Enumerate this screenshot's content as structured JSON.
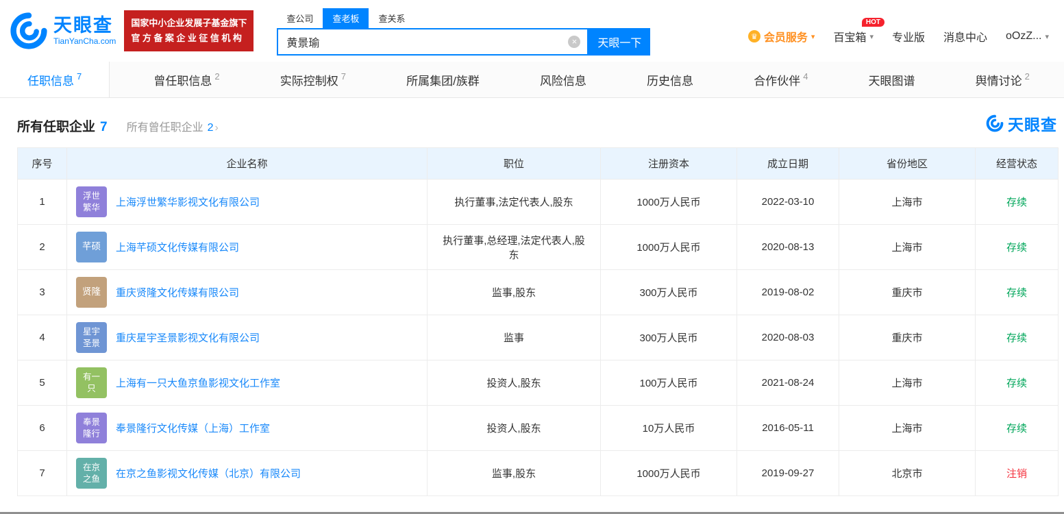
{
  "header": {
    "logo": {
      "brand": "天眼查",
      "domain": "TianYanCha.com"
    },
    "badge_line1": "国家中小企业发展子基金旗下",
    "badge_line2": "官方备案企业征信机构",
    "search": {
      "tabs": [
        {
          "name": "search-company",
          "label": "查公司",
          "active": false
        },
        {
          "name": "search-boss",
          "label": "查老板",
          "active": true
        },
        {
          "name": "search-relation",
          "label": "查关系",
          "active": false
        }
      ],
      "value": "黄景瑜",
      "button": "天眼一下"
    },
    "nav": [
      {
        "name": "vip-services",
        "label": "会员服务",
        "icon": "crown-icon",
        "accent": true,
        "caret": true
      },
      {
        "name": "toolbox",
        "label": "百宝箱",
        "badge": "HOT",
        "caret": true
      },
      {
        "name": "pro-version",
        "label": "专业版"
      },
      {
        "name": "message-center",
        "label": "消息中心"
      },
      {
        "name": "user-menu",
        "label": "oOzZ...",
        "caret": true
      }
    ]
  },
  "tabs": [
    {
      "name": "employment-info",
      "label": "任职信息",
      "count": "7",
      "active": true
    },
    {
      "name": "past-employment-info",
      "label": "曾任职信息",
      "count": "2",
      "active": false
    },
    {
      "name": "actual-control",
      "label": "实际控制权",
      "count": "7",
      "active": false
    },
    {
      "name": "group-cluster",
      "label": "所属集团/族群",
      "count": "",
      "active": false
    },
    {
      "name": "risk-info",
      "label": "风险信息",
      "count": "",
      "active": false
    },
    {
      "name": "history-info",
      "label": "历史信息",
      "count": "",
      "active": false
    },
    {
      "name": "partners",
      "label": "合作伙伴",
      "count": "4",
      "active": false
    },
    {
      "name": "tianyan-graph",
      "label": "天眼图谱",
      "count": "",
      "active": false
    },
    {
      "name": "public-opinion",
      "label": "舆情讨论",
      "count": "2",
      "active": false
    }
  ],
  "section": {
    "title": "所有任职企业",
    "title_count": "7",
    "sub": "所有曾任职企业",
    "sub_count": "2",
    "watermark": "天眼查"
  },
  "table": {
    "headers": [
      "序号",
      "企业名称",
      "职位",
      "注册资本",
      "成立日期",
      "省份地区",
      "经营状态"
    ],
    "status_colors": {
      "active": "#00a65a",
      "cancelled": "#f5333f"
    },
    "rows": [
      {
        "no": "1",
        "avatar_lines": [
          "浮世",
          "繁华"
        ],
        "avatar_color": "#8f80da",
        "company": "上海浮世繁华影视文化有限公司",
        "position": "执行董事,法定代表人,股东",
        "capital": "1000万人民币",
        "date": "2022-03-10",
        "region": "上海市",
        "status": "存续",
        "status_type": "active"
      },
      {
        "no": "2",
        "avatar_lines": [
          "芊硕"
        ],
        "avatar_color": "#6f9fd8",
        "company": "上海芊硕文化传媒有限公司",
        "position": "执行董事,总经理,法定代表人,股东",
        "capital": "1000万人民币",
        "date": "2020-08-13",
        "region": "上海市",
        "status": "存续",
        "status_type": "active"
      },
      {
        "no": "3",
        "avatar_lines": [
          "贤隆"
        ],
        "avatar_color": "#c2a17c",
        "company": "重庆贤隆文化传媒有限公司",
        "position": "监事,股东",
        "capital": "300万人民币",
        "date": "2019-08-02",
        "region": "重庆市",
        "status": "存续",
        "status_type": "active"
      },
      {
        "no": "4",
        "avatar_lines": [
          "星宇",
          "圣景"
        ],
        "avatar_color": "#6f95d4",
        "company": "重庆星宇圣景影视文化有限公司",
        "position": "监事",
        "capital": "300万人民币",
        "date": "2020-08-03",
        "region": "重庆市",
        "status": "存续",
        "status_type": "active"
      },
      {
        "no": "5",
        "avatar_lines": [
          "有一",
          "只"
        ],
        "avatar_color": "#93c162",
        "company": "上海有一只大鱼京鱼影视文化工作室",
        "position": "投资人,股东",
        "capital": "100万人民币",
        "date": "2021-08-24",
        "region": "上海市",
        "status": "存续",
        "status_type": "active"
      },
      {
        "no": "6",
        "avatar_lines": [
          "奉景",
          "隆行"
        ],
        "avatar_color": "#8f80da",
        "company": "奉景隆行文化传媒（上海）工作室",
        "position": "投资人,股东",
        "capital": "10万人民币",
        "date": "2016-05-11",
        "region": "上海市",
        "status": "存续",
        "status_type": "active"
      },
      {
        "no": "7",
        "avatar_lines": [
          "在京",
          "之鱼"
        ],
        "avatar_color": "#63b0a9",
        "company": "在京之鱼影视文化传媒（北京）有限公司",
        "position": "监事,股东",
        "capital": "1000万人民币",
        "date": "2019-09-27",
        "region": "北京市",
        "status": "注销",
        "status_type": "cancelled"
      }
    ]
  }
}
